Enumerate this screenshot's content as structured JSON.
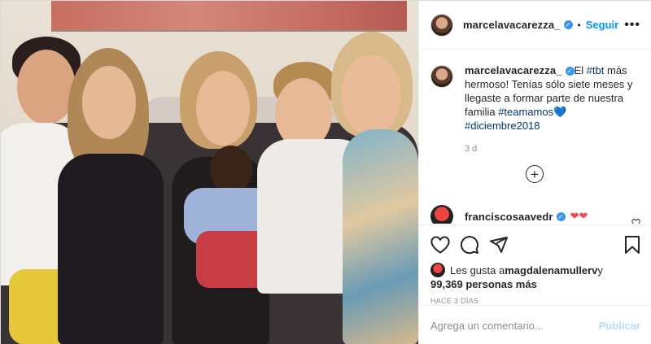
{
  "post": {
    "username": "marcelavacarezza_",
    "follow_label": "Seguir",
    "more_label": "•••"
  },
  "caption": {
    "username": "marcelavacarezza_",
    "text_1": "El ",
    "tag_1": "#tbt",
    "text_2": " más hermoso! Tenías sólo siete meses y llegaste a formar parte de nuestra familia ",
    "tag_2": "#teamamos",
    "heart": "💙",
    "tag_3": "#diciembre2018",
    "time": "3 d"
  },
  "load_more": "+",
  "reply": {
    "username": "franciscosaavedr",
    "text": "❤❤"
  },
  "likes": {
    "prefix": "Les gusta a ",
    "user": "magdalenamullerv",
    "conj": " y",
    "count_text": "99,369 personas más",
    "ago": "HACE 3 DÍAS"
  },
  "comment_box": {
    "placeholder": "Agrega un comentario...",
    "publish_label": "Publicar"
  },
  "icons": {
    "like": "heart-icon",
    "comment": "comment-icon",
    "share": "share-icon",
    "save": "bookmark-icon"
  },
  "colors": {
    "accent": "#0095f6",
    "heart": "#ed4956",
    "publish_disabled": "#b2dffc"
  }
}
